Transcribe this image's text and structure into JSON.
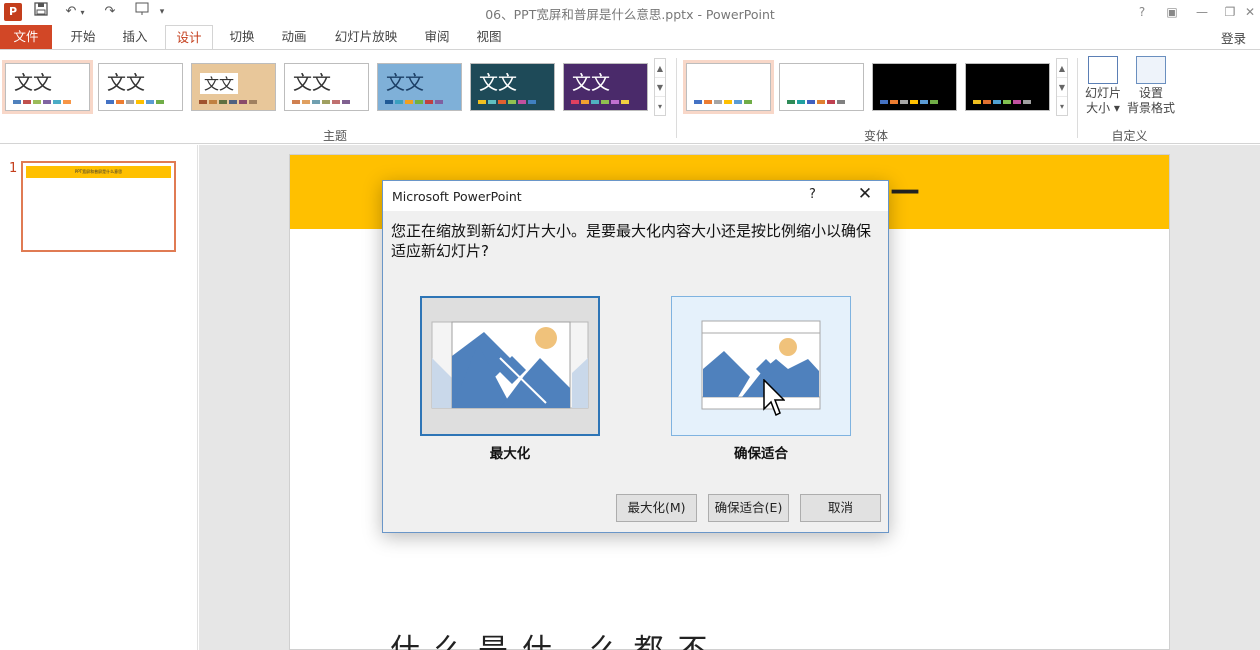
{
  "window": {
    "app_icon": "P",
    "title": "06、PPT宽屏和普屏是什么意思.pptx - PowerPoint",
    "controls": [
      "?",
      "▣",
      "—",
      "❐",
      "✕"
    ]
  },
  "quick_access": [
    "save-icon",
    "undo-icon",
    "redo-icon",
    "slideshow-icon",
    "customize-icon"
  ],
  "tabs": {
    "file": "文件",
    "items": [
      "开始",
      "插入",
      "设计",
      "切换",
      "动画",
      "幻灯片放映",
      "审阅",
      "视图"
    ],
    "active": "设计",
    "login": "登录"
  },
  "ribbon": {
    "themes_label": "主题",
    "theme_sample": "文文",
    "variants_label": "变体",
    "customize_label": "自定义",
    "slide_size": {
      "line1": "幻灯片",
      "line2": "大小 ▾"
    },
    "format_background": {
      "line1": "设置",
      "line2": "背景格式"
    }
  },
  "thumbnails": {
    "slide_number": "1",
    "thumb_title": "PPT宽屏和普屏是什么意思"
  },
  "slide": {
    "title_tail": "—",
    "partial_bottom_text": "什么是什 么都不"
  },
  "dialog": {
    "title": "Microsoft PowerPoint",
    "help": "?",
    "close": "✕",
    "message": "您正在缩放到新幻灯片大小。是要最大化内容大小还是按比例缩小以确保适应新幻灯片?",
    "option_max": "最大化",
    "option_fit": "确保适合",
    "btn_max": "最大化(M)",
    "btn_fit": "确保适合(E)",
    "btn_cancel": "取消"
  },
  "colors": {
    "accent": "#d24726",
    "slide_header": "#ffc000",
    "dialog_selection": "#2e75b6",
    "image_blue": "#4f81bd",
    "sun": "#f0c27b"
  }
}
